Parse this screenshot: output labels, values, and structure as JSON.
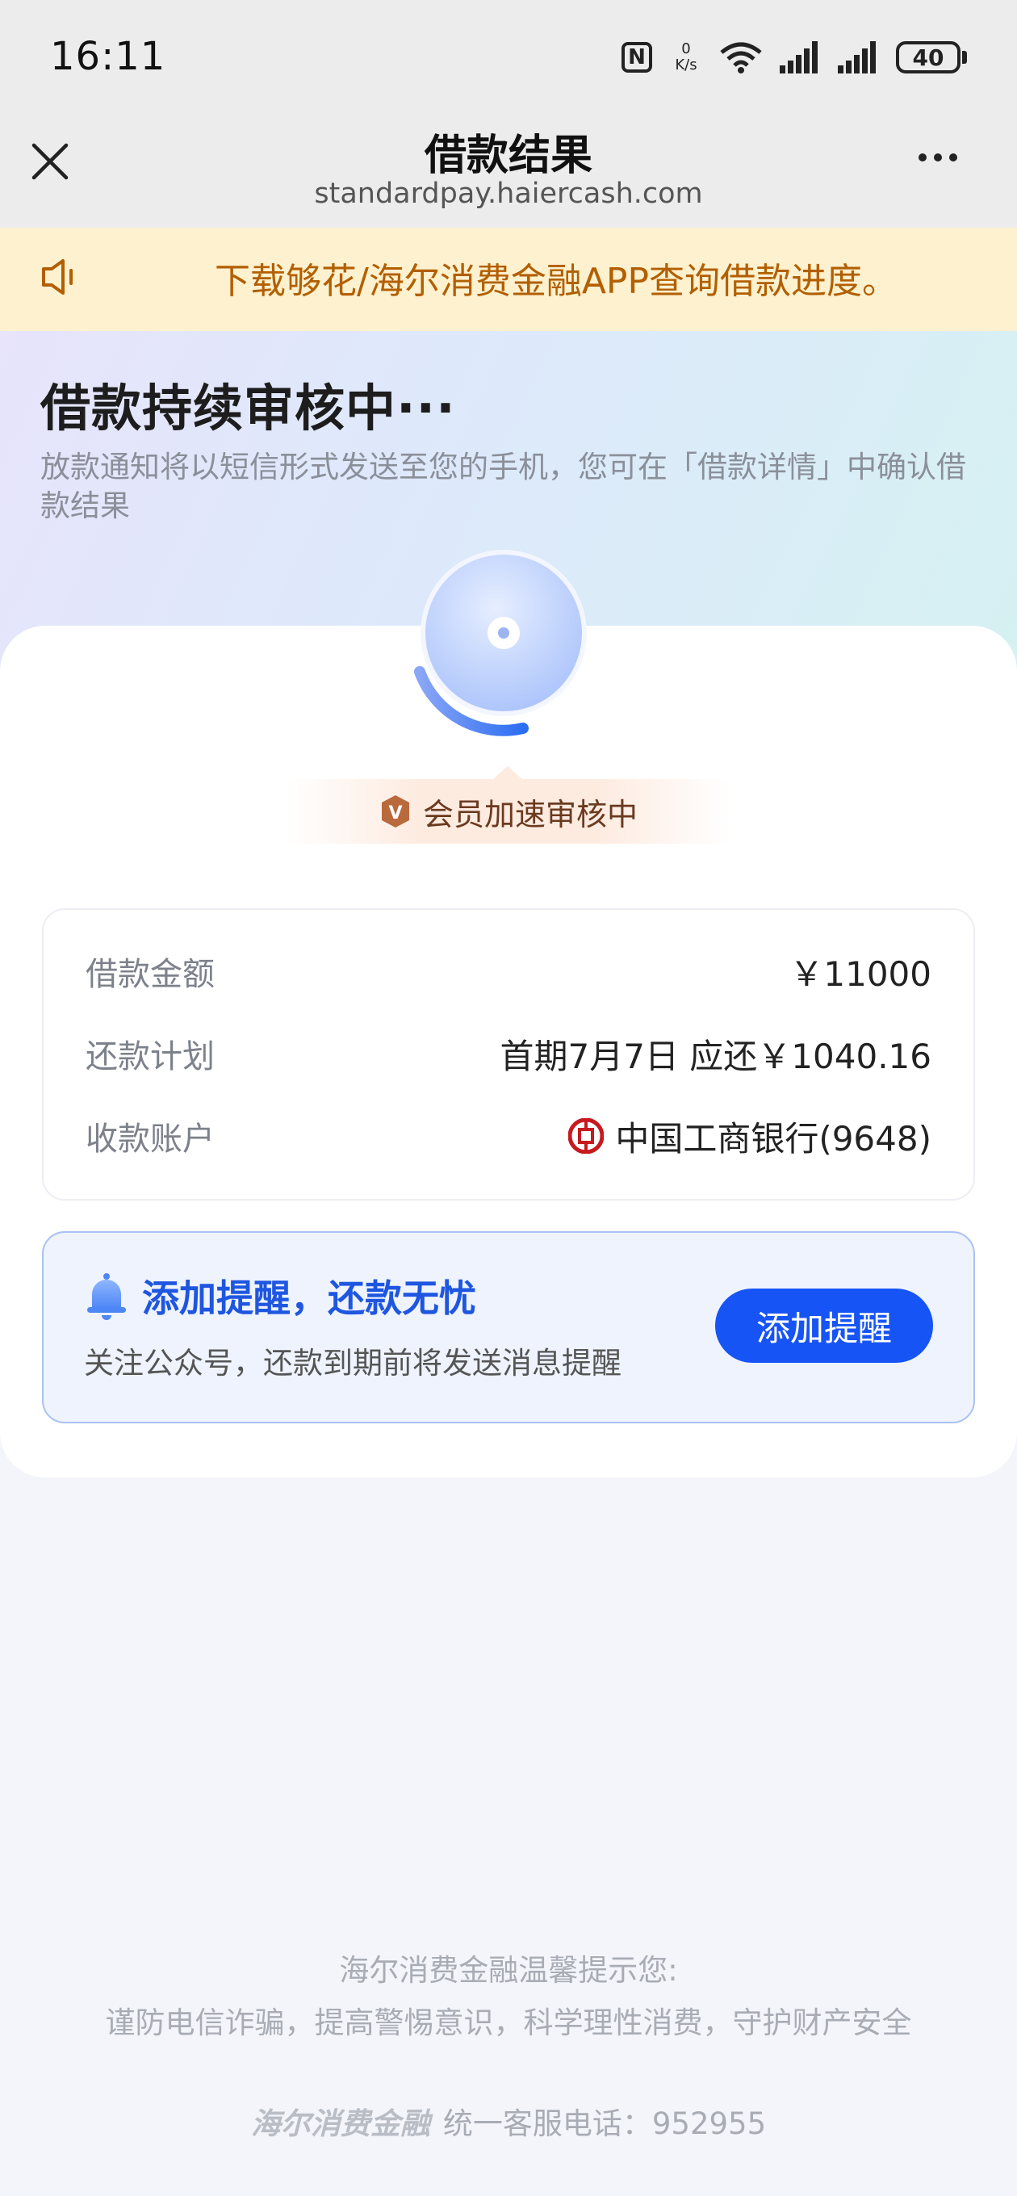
{
  "status_bar": {
    "time": "16:11",
    "nfc": "N",
    "net_speed_value": "0",
    "net_speed_unit": "K/s",
    "battery": "40"
  },
  "nav": {
    "title": "借款结果",
    "url": "standardpay.haiercash.com"
  },
  "notice": {
    "text": "下载够花/海尔消费金融APP查询借款进度。"
  },
  "hero": {
    "title": "借款持续审核中···",
    "subtitle": "放款通知将以短信形式发送至您的手机，您可在「借款详情」中确认借款结果"
  },
  "vip": {
    "badge": "V",
    "label": "会员加速审核中"
  },
  "loan_info": {
    "amount_label": "借款金额",
    "amount_value": "￥11000",
    "plan_label": "还款计划",
    "plan_value": "首期7月7日 应还￥1040.16",
    "account_label": "收款账户",
    "account_value": "中国工商银行(9648)"
  },
  "reminder": {
    "title": "添加提醒，还款无忧",
    "subtitle": "关注公众号，还款到期前将发送消息提醒",
    "button": "添加提醒"
  },
  "footer": {
    "line1": "海尔消费金融温馨提示您:",
    "line2": "谨防电信诈骗，提高警惕意识，科学理性消费，守护财产安全",
    "brand": "海尔消费金融",
    "hotline": "统一客服电话：952955"
  },
  "colors": {
    "accent": "#1754f5",
    "notice_text": "#b25f00",
    "notice_bg": "#fdf1cf"
  }
}
